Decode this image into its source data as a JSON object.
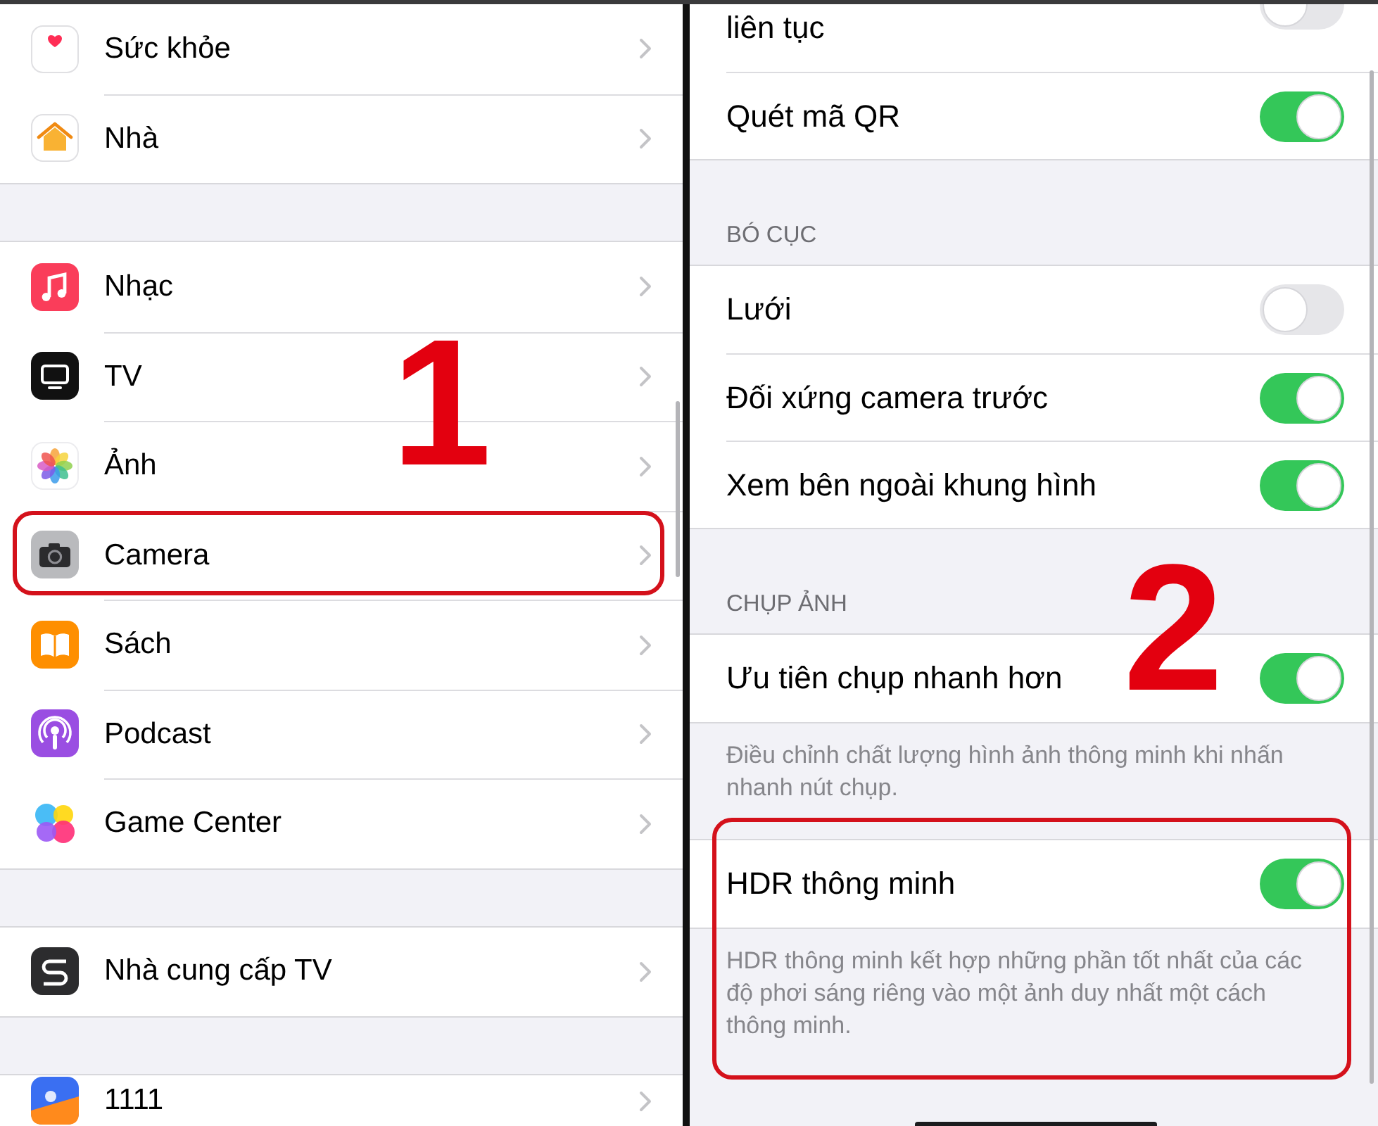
{
  "left_panel": {
    "groups": [
      {
        "items": [
          {
            "label": "Sức khỏe",
            "highlighted": false
          },
          {
            "label": "Nhà",
            "highlighted": false
          }
        ]
      },
      {
        "items": [
          {
            "label": "Nhạc",
            "highlighted": false
          },
          {
            "label": "TV",
            "highlighted": false
          },
          {
            "label": "Ảnh",
            "highlighted": false
          },
          {
            "label": "Camera",
            "highlighted": true
          },
          {
            "label": "Sách",
            "highlighted": false
          },
          {
            "label": "Podcast",
            "highlighted": false
          },
          {
            "label": "Game Center",
            "highlighted": false
          }
        ]
      },
      {
        "items": [
          {
            "label": "Nhà cung cấp TV",
            "highlighted": false
          }
        ]
      },
      {
        "items": [
          {
            "label": "1111",
            "highlighted": false
          }
        ]
      }
    ],
    "step_number": "1"
  },
  "right_panel": {
    "groups": [
      {
        "highlighted": false,
        "rows": [
          {
            "label": "liên tục",
            "on": false
          },
          {
            "label": "Quét mã QR",
            "on": true
          }
        ]
      },
      {
        "header": "BÓ CỤC",
        "highlighted": false,
        "rows": [
          {
            "label": "Lưới",
            "on": false
          },
          {
            "label": "Đối xứng camera trước",
            "on": true
          },
          {
            "label": "Xem bên ngoài khung hình",
            "on": true
          }
        ]
      },
      {
        "header": "CHỤP ẢNH",
        "highlighted": false,
        "rows": [
          {
            "label": "Ưu tiên chụp nhanh hơn",
            "on": true
          }
        ],
        "footer": "Điều chỉnh chất lượng hình ảnh thông minh khi nhấn nhanh nút chụp."
      },
      {
        "highlighted": true,
        "rows": [
          {
            "label": "HDR thông minh",
            "on": true
          }
        ],
        "footer": "HDR thông minh kết hợp những phần tốt nhất của các độ phơi sáng riêng vào một ảnh duy nhất một cách thông minh."
      }
    ],
    "step_number": "2"
  }
}
